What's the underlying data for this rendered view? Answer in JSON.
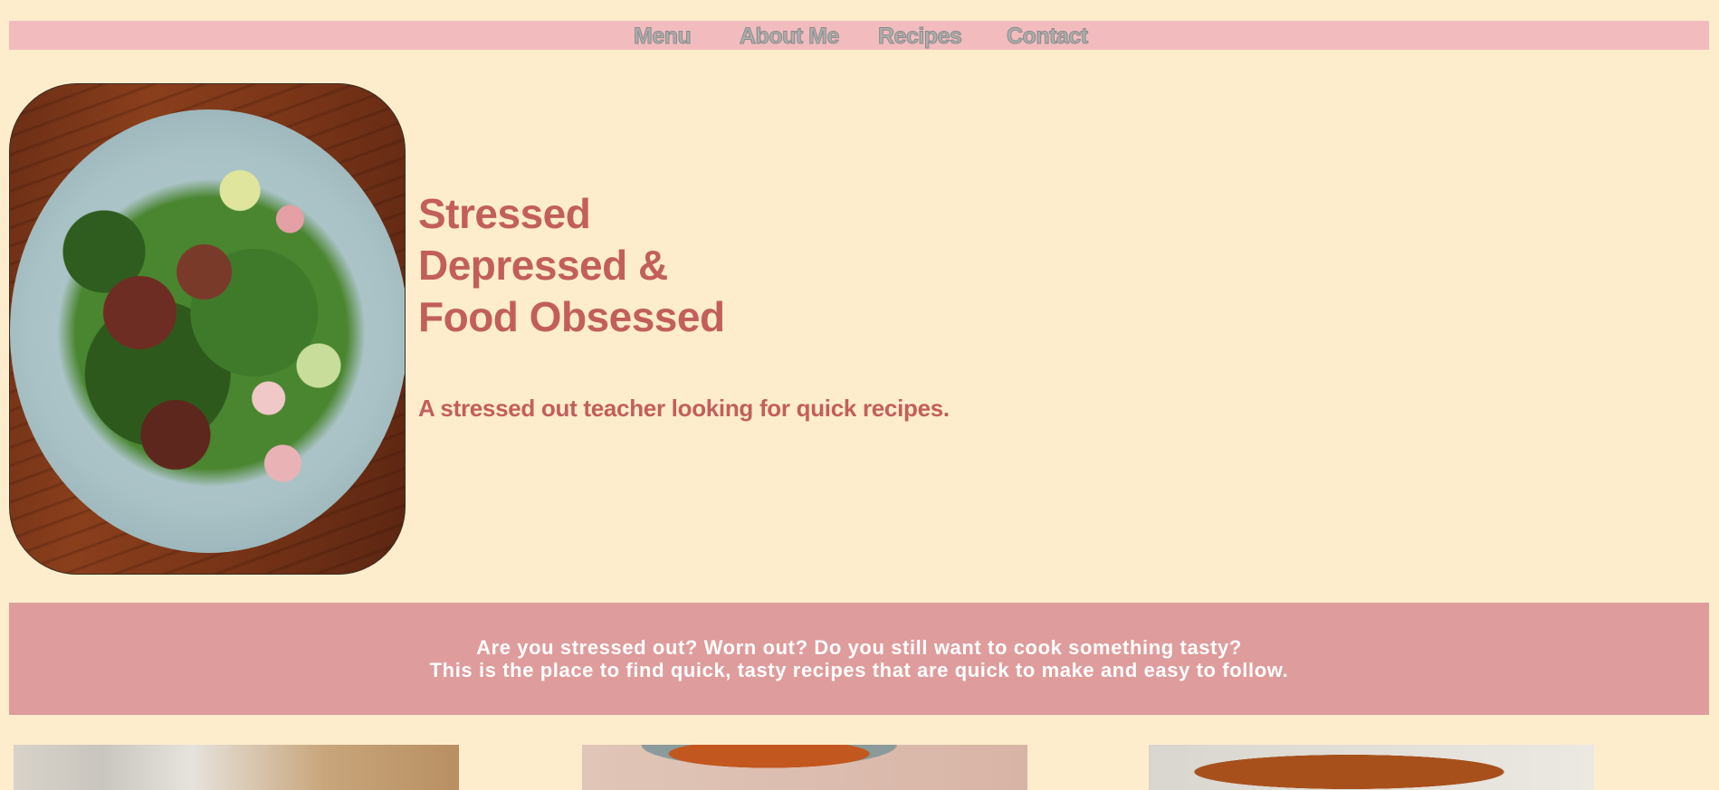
{
  "nav": {
    "items": [
      {
        "label": "Menu"
      },
      {
        "label": "About Me"
      },
      {
        "label": "Recipes"
      },
      {
        "label": "Contact"
      }
    ]
  },
  "hero": {
    "title_line1": "Stressed",
    "title_line2": "Depressed &",
    "title_line3": "Food Obsessed",
    "tagline": "A stressed out teacher looking for quick recipes."
  },
  "intro": {
    "line1": "Are you stressed out? Worn out? Do you still want to cook something tasty?",
    "line2": "This is the place to find quick, tasty recipes that are quick to make and easy to follow."
  },
  "colors": {
    "background": "#feedcd",
    "nav_bar": "#f2bcbe",
    "accent_text": "#c25f5b",
    "banner": "#df9c9c"
  }
}
